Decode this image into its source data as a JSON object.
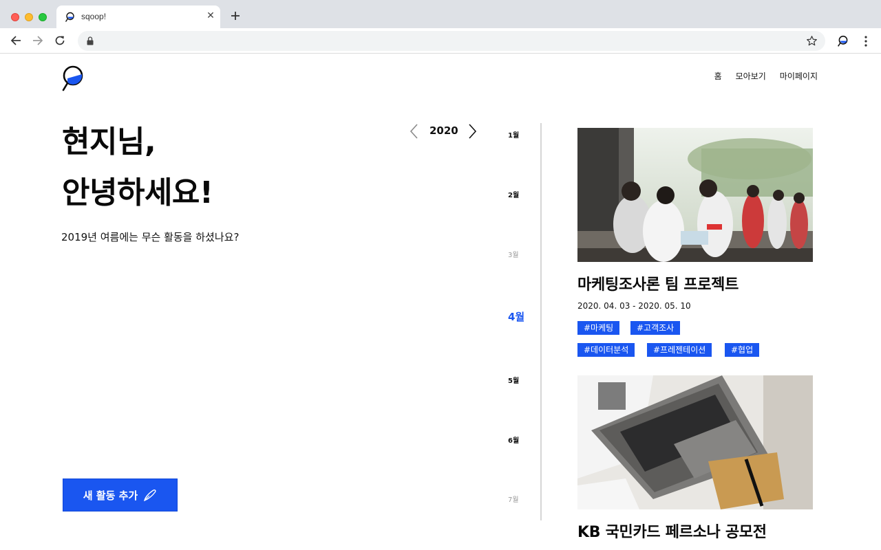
{
  "browser": {
    "tab_title": "sqoop!",
    "tab_close": "✕",
    "new_tab": "+",
    "url": ""
  },
  "nav": {
    "home": "홈",
    "browse": "모아보기",
    "mypage": "마이페이지"
  },
  "greeting": {
    "line1": "현지님,",
    "line2": "안녕하세요!",
    "question": "2019년 여름에는 무슨 활동을 하셨나요?"
  },
  "year_nav": {
    "year": "2020"
  },
  "months": [
    {
      "label": "1월",
      "state": "normal"
    },
    {
      "label": "2월",
      "state": "normal"
    },
    {
      "label": "3월",
      "state": "dim"
    },
    {
      "label": "4월",
      "state": "active"
    },
    {
      "label": "5월",
      "state": "normal"
    },
    {
      "label": "6월",
      "state": "normal"
    },
    {
      "label": "7월",
      "state": "dim"
    }
  ],
  "add_button": {
    "label": "새 활동 추가"
  },
  "activities": [
    {
      "title": "마케팅조사론 팀 프로젝트",
      "date": "2020. 04. 03 - 2020. 05. 10",
      "tags": [
        "#마케팅",
        "#고객조사",
        "#데이터분석",
        "#프레젠테이션",
        "#협업"
      ]
    },
    {
      "title": "KB 국민카드 페르소나 공모전"
    }
  ],
  "colors": {
    "accent": "#1a56f0",
    "text": "#111111",
    "dim_month": "#9a9a9a"
  }
}
